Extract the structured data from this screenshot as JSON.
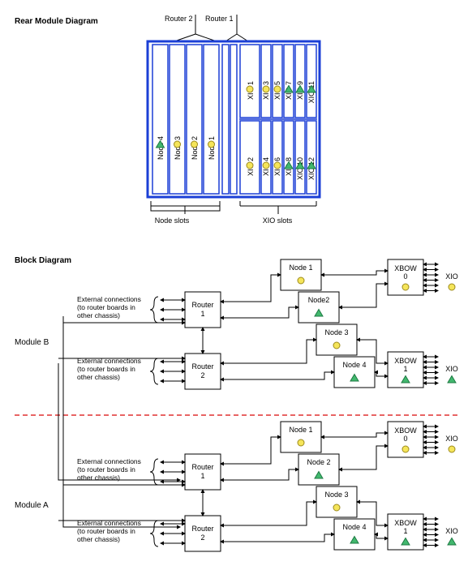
{
  "titles": {
    "rear": "Rear Module Diagram",
    "block": "Block Diagram"
  },
  "rear": {
    "router_labels": {
      "r2": "Router 2",
      "r1": "Router 1"
    },
    "bottom_labels": {
      "node": "Node slots",
      "xio": "XIO slots"
    },
    "nodes": [
      {
        "label": "Node 4",
        "shape": "triangle"
      },
      {
        "label": "Node 3",
        "shape": "circle"
      },
      {
        "label": "Node 2",
        "shape": "circle"
      },
      {
        "label": "Node 1",
        "shape": "circle"
      }
    ],
    "xio_top": [
      {
        "label": "XIO 1",
        "shape": "circle"
      },
      {
        "label": "XIO 3",
        "shape": "circle"
      },
      {
        "label": "XIO 5",
        "shape": "circle"
      },
      {
        "label": "XIO 7",
        "shape": "triangle"
      },
      {
        "label": "XIO 9",
        "shape": "triangle"
      },
      {
        "label": "XIO 11",
        "shape": "triangle"
      }
    ],
    "xio_bottom": [
      {
        "label": "XIO 2",
        "shape": "circle"
      },
      {
        "label": "XIO 4",
        "shape": "circle"
      },
      {
        "label": "XIO 6",
        "shape": "circle"
      },
      {
        "label": "XIO 8",
        "shape": "triangle"
      },
      {
        "label": "XIO 10",
        "shape": "triangle"
      },
      {
        "label": "XIO 12",
        "shape": "triangle"
      }
    ]
  },
  "block": {
    "module_b": "Module B",
    "module_a": "Module A",
    "ext_conn": "External connections\n(to router boards in\nother chassis)",
    "router1": "Router\n1",
    "router2": "Router\n2",
    "nodes": [
      {
        "label": "Node 1",
        "shape": "circle"
      },
      {
        "label": "Node2",
        "shape": "triangle"
      },
      {
        "label": "Node 3",
        "shape": "circle"
      },
      {
        "label": "Node 4",
        "shape": "triangle"
      }
    ],
    "nodes_a": [
      {
        "label": "Node 1",
        "shape": "circle"
      },
      {
        "label": "Node 2",
        "shape": "triangle"
      },
      {
        "label": "Node 3",
        "shape": "circle"
      },
      {
        "label": "Node 4",
        "shape": "triangle"
      }
    ],
    "xbow0": "XBOW\n0",
    "xbow1": "XBOW\n1",
    "xio_label": "XIO"
  },
  "colors": {
    "blue": "#1b3fd6",
    "yellow_fill": "#f5e55a",
    "yellow_stroke": "#9c8a1c",
    "green_fill": "#42b86e",
    "green_stroke": "#1d7a43",
    "red": "#e03030"
  }
}
